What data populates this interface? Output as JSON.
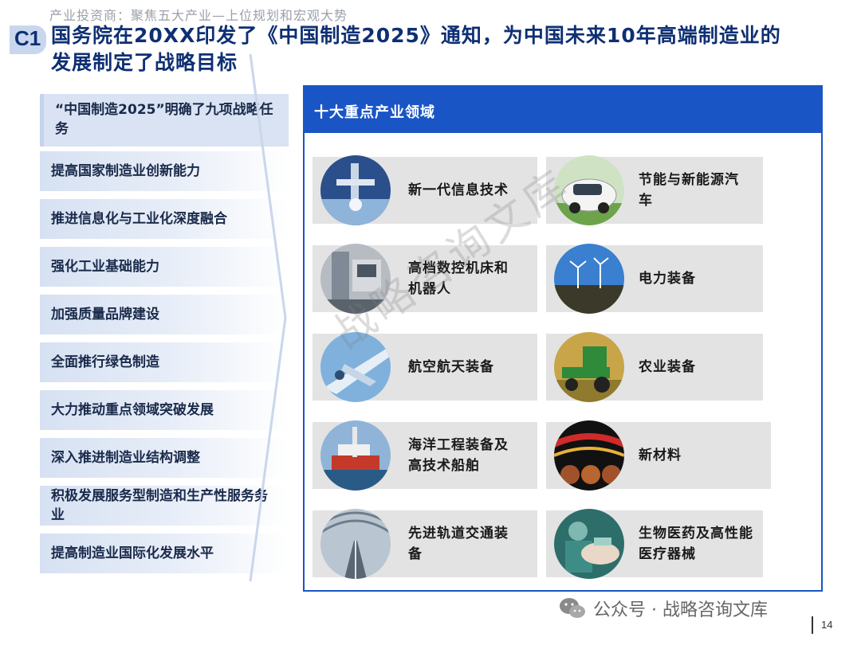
{
  "header": {
    "subtitle": "产业投资商：聚焦五大产业—上位规划和宏观大势",
    "badge": "C1",
    "title_line1": "国务院在20XX印发了《中国制造2025》通知，为中国未来10年高端制造业的",
    "title_line2": "发展制定了战略目标"
  },
  "left": {
    "heading": "“中国制造2025”明确了九项战略任务",
    "items": [
      "提高国家制造业创新能力",
      "推进信息化与工业化深度融合",
      "强化工业基础能力",
      "加强质量品牌建设",
      "全面推行绿色制造",
      "大力推动重点领域突破发展",
      "深入推进制造业结构调整",
      "积极发展服务型制造和生产性服务务业",
      "提高制造业国际化发展水平"
    ]
  },
  "panel": {
    "heading": "十大重点产业领域",
    "fields": [
      {
        "label": "新一代信息技术",
        "icon": "robot-arm-icon"
      },
      {
        "label": "节能与新能源汽车",
        "icon": "electric-car-icon"
      },
      {
        "label": "高档数控机床和机器人",
        "icon": "cnc-machine-icon"
      },
      {
        "label": "电力装备",
        "icon": "wind-turbine-icon"
      },
      {
        "label": "航空航天装备",
        "icon": "airplane-icon"
      },
      {
        "label": "农业装备",
        "icon": "harvester-icon"
      },
      {
        "label": "海洋工程装备及高技术船舶",
        "icon": "offshore-rig-icon"
      },
      {
        "label": "新材料",
        "icon": "cable-material-icon"
      },
      {
        "label": "先进轨道交通装备",
        "icon": "rail-tunnel-icon"
      },
      {
        "label": "生物医药及高性能医疗器械",
        "icon": "surgery-icon"
      }
    ]
  },
  "watermark": "战略咨询文库",
  "footer": {
    "account": "公众号 · 战略咨询文库",
    "page": "14"
  },
  "colors": {
    "accent": "#1a55c6",
    "title": "#0e2f73",
    "card_bg": "#e3e3e3",
    "left_bg": "#d9e3f3"
  }
}
